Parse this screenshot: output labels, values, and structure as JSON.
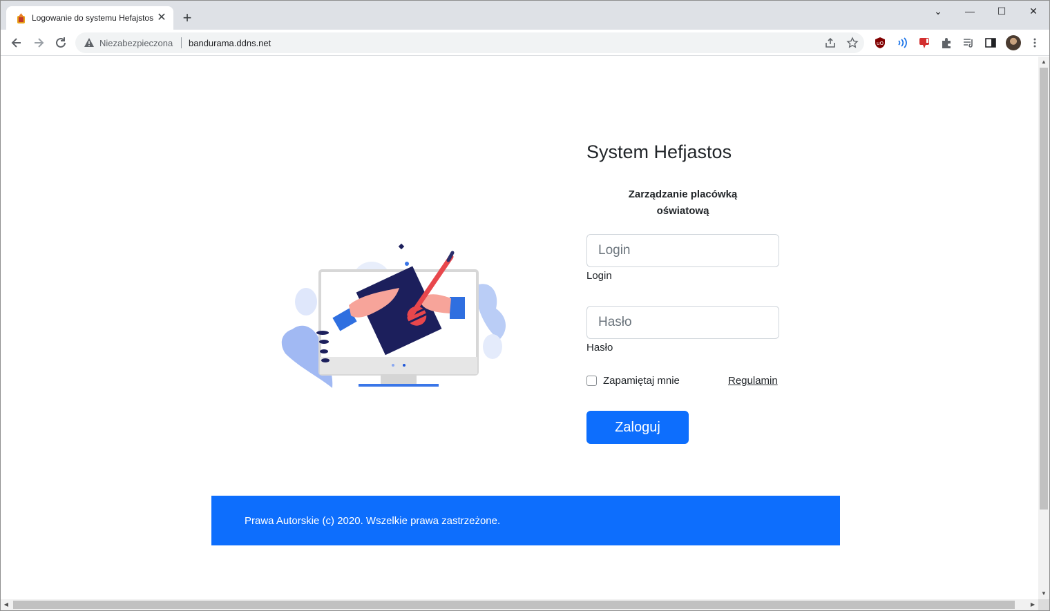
{
  "browser": {
    "tab_title": "Logowanie do systemu Hefajstos",
    "tab_close": "✕",
    "new_tab": "+",
    "window_controls": {
      "tabsearch": "⌄",
      "minimize": "—",
      "maximize": "☐",
      "close": "✕"
    },
    "security_label": "Niezabezpieczona",
    "url": "bandurama.ddns.net"
  },
  "page": {
    "heading": "System Hefjastos",
    "subtitle_line1": "Zarządzanie placówką",
    "subtitle_line2": "oświatową",
    "login_placeholder": "Login",
    "login_label": "Login",
    "password_placeholder": "Hasło",
    "password_label": "Hasło",
    "remember_label": "Zapamiętaj mnie",
    "terms_link": "Regulamin",
    "submit_label": "Zaloguj",
    "footer_text": "Prawa Autorskie (c) 2020. Wszelkie prawa zastrzeżone."
  },
  "colors": {
    "primary": "#0d6efd",
    "tabstrip": "#dee1e6",
    "text": "#212529"
  }
}
